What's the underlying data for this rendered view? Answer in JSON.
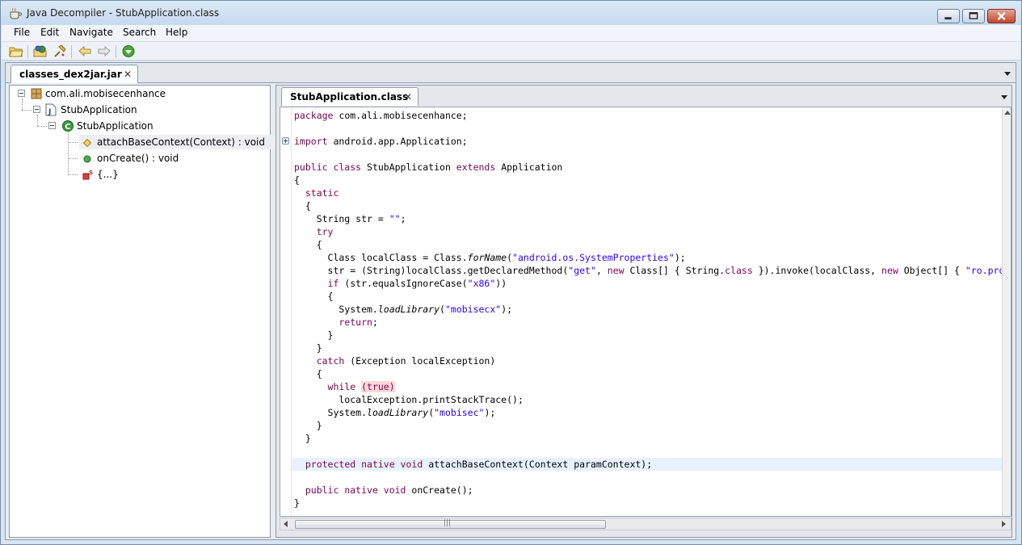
{
  "window": {
    "title": "Java Decompiler - StubApplication.class"
  },
  "menu": {
    "items": [
      "File",
      "Edit",
      "Navigate",
      "Search",
      "Help"
    ]
  },
  "toolbar": {
    "icons": [
      "open-file-icon",
      "open-type-icon",
      "search-icon",
      "back-icon",
      "forward-icon",
      "jd-online-icon"
    ]
  },
  "jar_tab": {
    "label": "classes_dex2jar.jar",
    "close": "✕"
  },
  "tree": {
    "package": "com.ali.mobisecenhance",
    "file": "StubApplication",
    "class": "StubApplication",
    "members": [
      {
        "label": "attachBaseContext(Context) : void",
        "icon": "protected-method-icon",
        "selected": true
      },
      {
        "label": "onCreate() : void",
        "icon": "public-method-icon",
        "selected": false
      },
      {
        "label": "{...}",
        "icon": "static-initializer-icon",
        "selected": false
      }
    ]
  },
  "code_tab": {
    "label": "StubApplication.class",
    "close": "✕"
  },
  "code": {
    "lines": [
      [
        {
          "t": "package",
          "c": "kw"
        },
        {
          "t": " com.ali.mobisecenhance;"
        }
      ],
      [],
      [
        {
          "t": "import",
          "c": "kw"
        },
        {
          "t": " android.app.Application;"
        }
      ],
      [],
      [
        {
          "t": "public class",
          "c": "kw"
        },
        {
          "t": " StubApplication "
        },
        {
          "t": "extends",
          "c": "kw"
        },
        {
          "t": " Application"
        }
      ],
      [
        {
          "t": "{"
        }
      ],
      [
        {
          "t": "  "
        },
        {
          "t": "static",
          "c": "kw"
        }
      ],
      [
        {
          "t": "  {"
        }
      ],
      [
        {
          "t": "    String str = "
        },
        {
          "t": "\"\"",
          "c": "str"
        },
        {
          "t": ";"
        }
      ],
      [
        {
          "t": "    "
        },
        {
          "t": "try",
          "c": "kw"
        }
      ],
      [
        {
          "t": "    {"
        }
      ],
      [
        {
          "t": "      Class localClass = Class."
        },
        {
          "t": "forName",
          "c": "it"
        },
        {
          "t": "("
        },
        {
          "t": "\"android.os.SystemProperties\"",
          "c": "str"
        },
        {
          "t": ");"
        }
      ],
      [
        {
          "t": "      str = (String)localClass.getDeclaredMethod("
        },
        {
          "t": "\"get\"",
          "c": "str"
        },
        {
          "t": ", "
        },
        {
          "t": "new",
          "c": "kw"
        },
        {
          "t": " Class[] { String."
        },
        {
          "t": "class",
          "c": "kw"
        },
        {
          "t": " }).invoke(localClass, "
        },
        {
          "t": "new",
          "c": "kw"
        },
        {
          "t": " Object[] { "
        },
        {
          "t": "\"ro.product.cpu.abi\"",
          "c": "str"
        }
      ],
      [
        {
          "t": "      "
        },
        {
          "t": "if",
          "c": "kw"
        },
        {
          "t": " (str.equalsIgnoreCase("
        },
        {
          "t": "\"x86\"",
          "c": "str"
        },
        {
          "t": "))"
        }
      ],
      [
        {
          "t": "      {"
        }
      ],
      [
        {
          "t": "        System."
        },
        {
          "t": "loadLibrary",
          "c": "it"
        },
        {
          "t": "("
        },
        {
          "t": "\"mobisecx\"",
          "c": "str"
        },
        {
          "t": ");"
        }
      ],
      [
        {
          "t": "        "
        },
        {
          "t": "return",
          "c": "kw"
        },
        {
          "t": ";"
        }
      ],
      [
        {
          "t": "      }"
        }
      ],
      [
        {
          "t": "    }"
        }
      ],
      [
        {
          "t": "    "
        },
        {
          "t": "catch",
          "c": "kw"
        },
        {
          "t": " (Exception localException)"
        }
      ],
      [
        {
          "t": "    {"
        }
      ],
      [
        {
          "t": "      "
        },
        {
          "t": "while",
          "c": "kw"
        },
        {
          "t": " "
        },
        {
          "t": "(true)",
          "c": "kw err"
        }
      ],
      [
        {
          "t": "        localException.printStackTrace();"
        }
      ],
      [
        {
          "t": "      System."
        },
        {
          "t": "loadLibrary",
          "c": "it"
        },
        {
          "t": "("
        },
        {
          "t": "\"mobisec\"",
          "c": "str"
        },
        {
          "t": ");"
        }
      ],
      [
        {
          "t": "    }"
        }
      ],
      [
        {
          "t": "  }"
        }
      ],
      [],
      [
        {
          "t": "  "
        },
        {
          "t": "protected native void",
          "c": "kw"
        },
        {
          "t": " attachBaseContext(Context paramContext);"
        }
      ],
      [],
      [
        {
          "t": "  "
        },
        {
          "t": "public native void",
          "c": "kw"
        },
        {
          "t": " onCreate();"
        }
      ],
      [
        {
          "t": "}"
        }
      ]
    ],
    "highlighted_line": 27,
    "folded_line": 2
  },
  "scrollbar": {
    "grip": "|||"
  }
}
